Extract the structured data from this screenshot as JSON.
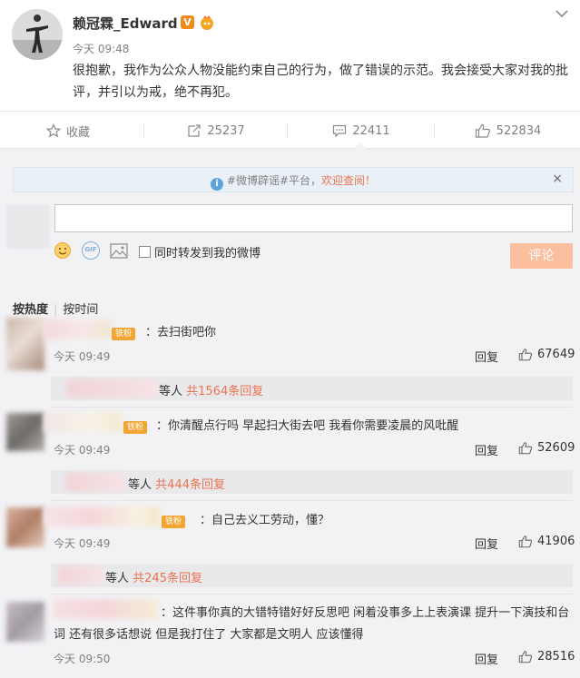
{
  "post": {
    "username": "赖冠霖_Edward",
    "verified_badge": "V",
    "time": "今天 09:48",
    "text": "很抱歉，我作为公众人物没能约束自己的行为，做了错误的示范。我会接受大家对我的批评，并引以为戒，绝不再犯。"
  },
  "actions": {
    "favorite_label": "收藏",
    "repost_count": "25237",
    "comment_count": "22411",
    "like_count": "522834"
  },
  "notice": {
    "info": "i",
    "prefix": "#微博辟谣#平台，",
    "welcome": "欢迎查阅！",
    "close": "×"
  },
  "composer": {
    "forward_label": "同时转发到我的微博",
    "submit_label": "评论",
    "gif_label": "GIF"
  },
  "sort": {
    "hot": "按热度",
    "separator": "|",
    "time": "按时间"
  },
  "fan_badge_label": "铁粉",
  "comments": [
    {
      "text": "：去扫街吧你",
      "time": "今天 09:49",
      "reply_label": "回复",
      "likes": "67649",
      "sub_suffix": "等人",
      "sub_count": "共1564条回复"
    },
    {
      "text": "：你清醒点行吗 早起扫大街去吧 我看你需要凌晨的风吡醒",
      "time": "今天 09:49",
      "reply_label": "回复",
      "likes": "52609",
      "sub_suffix": "等人",
      "sub_count": "共444条回复"
    },
    {
      "text": "：自己去义工劳动，懂？",
      "time": "今天 09:49",
      "reply_label": "回复",
      "likes": "41906",
      "sub_suffix": "等人",
      "sub_count": "共245条回复"
    },
    {
      "text_line1": "：这件事你真的大错特错好好反思吧 闲着没事多上上表演课 提升一下演技和台",
      "text_line2": "词 还有很多话想说 但是我打住了 大家都是文明人 应该懂得",
      "time": "今天 09:50",
      "reply_label": "回复",
      "likes": "28516"
    }
  ],
  "colors": {
    "accent_orange": "#eb7350",
    "submit_disabled": "#fbbf9f",
    "comment_bg": "#f2f2f5",
    "notice_bg": "#eaf0f7",
    "verified": "#f08c1b"
  }
}
